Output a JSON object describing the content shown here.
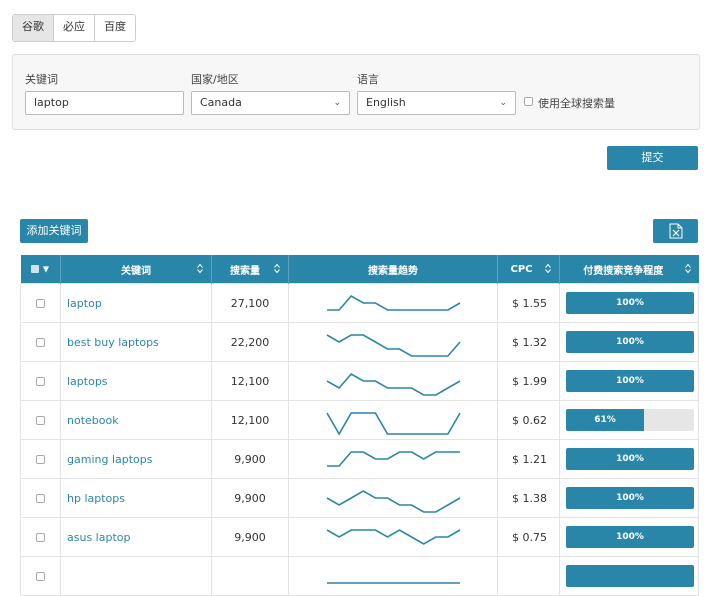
{
  "engine_tabs": [
    {
      "label": "谷歌",
      "active": true
    },
    {
      "label": "必应",
      "active": false
    },
    {
      "label": "百度",
      "active": false
    }
  ],
  "form": {
    "keyword_label": "关键词",
    "keyword_value": "laptop",
    "country_label": "国家/地区",
    "country_value": "Canada",
    "language_label": "语言",
    "language_value": "English",
    "global_search_label": "使用全球搜索量"
  },
  "submit_label": "提交",
  "add_keywords_label": "添加关键词",
  "export_icon": "excel-export-icon",
  "table": {
    "headers": {
      "keyword": "关键词",
      "volume": "搜索量",
      "trend": "搜索量趋势",
      "cpc": "CPC",
      "competition": "付费搜索竞争程度"
    },
    "rows": [
      {
        "keyword": "laptop",
        "volume": "27,100",
        "cpc": "$ 1.55",
        "competition_pct": 100,
        "competition_label": "100%",
        "trend": [
          0,
          0,
          2,
          1,
          1,
          0,
          0,
          0,
          0,
          0,
          0,
          1
        ]
      },
      {
        "keyword": "best buy laptops",
        "volume": "22,200",
        "cpc": "$ 1.32",
        "competition_pct": 100,
        "competition_label": "100%",
        "trend": [
          2,
          1,
          2,
          2,
          1,
          0,
          0,
          -1,
          -1,
          -1,
          -1,
          1
        ]
      },
      {
        "keyword": "laptops",
        "volume": "12,100",
        "cpc": "$ 1.99",
        "competition_pct": 100,
        "competition_label": "100%",
        "trend": [
          1,
          0,
          2,
          1,
          1,
          0,
          0,
          0,
          -1,
          -1,
          0,
          1
        ]
      },
      {
        "keyword": "notebook",
        "volume": "12,100",
        "cpc": "$ 0.62",
        "competition_pct": 61,
        "competition_label": "61%",
        "trend": [
          2,
          -1,
          2,
          2,
          2,
          -1,
          -1,
          -1,
          -1,
          -1,
          -1,
          2
        ]
      },
      {
        "keyword": "gaming laptops",
        "volume": "9,900",
        "cpc": "$ 1.21",
        "competition_pct": 100,
        "competition_label": "100%",
        "trend": [
          0,
          0,
          2,
          2,
          1,
          1,
          2,
          2,
          1,
          2,
          2,
          2
        ]
      },
      {
        "keyword": "hp laptops",
        "volume": "9,900",
        "cpc": "$ 1.38",
        "competition_pct": 100,
        "competition_label": "100%",
        "trend": [
          1,
          0,
          1,
          2,
          1,
          1,
          0,
          0,
          -1,
          -1,
          0,
          1
        ]
      },
      {
        "keyword": "asus laptop",
        "volume": "9,900",
        "cpc": "$ 0.75",
        "competition_pct": 100,
        "competition_label": "100%",
        "trend": [
          2,
          1,
          2,
          2,
          2,
          1,
          2,
          1,
          0,
          1,
          1,
          2
        ]
      },
      {
        "keyword": "",
        "volume": "",
        "cpc": "",
        "competition_pct": 100,
        "competition_label": "",
        "trend": [
          0,
          0,
          0,
          0,
          0,
          0,
          0,
          0,
          0,
          0,
          0,
          0
        ]
      }
    ]
  },
  "colors": {
    "primary": "#2a86a8",
    "link": "#2a86a8",
    "header_text": "#ffffff",
    "competition_bg": "#e6e6e6"
  }
}
